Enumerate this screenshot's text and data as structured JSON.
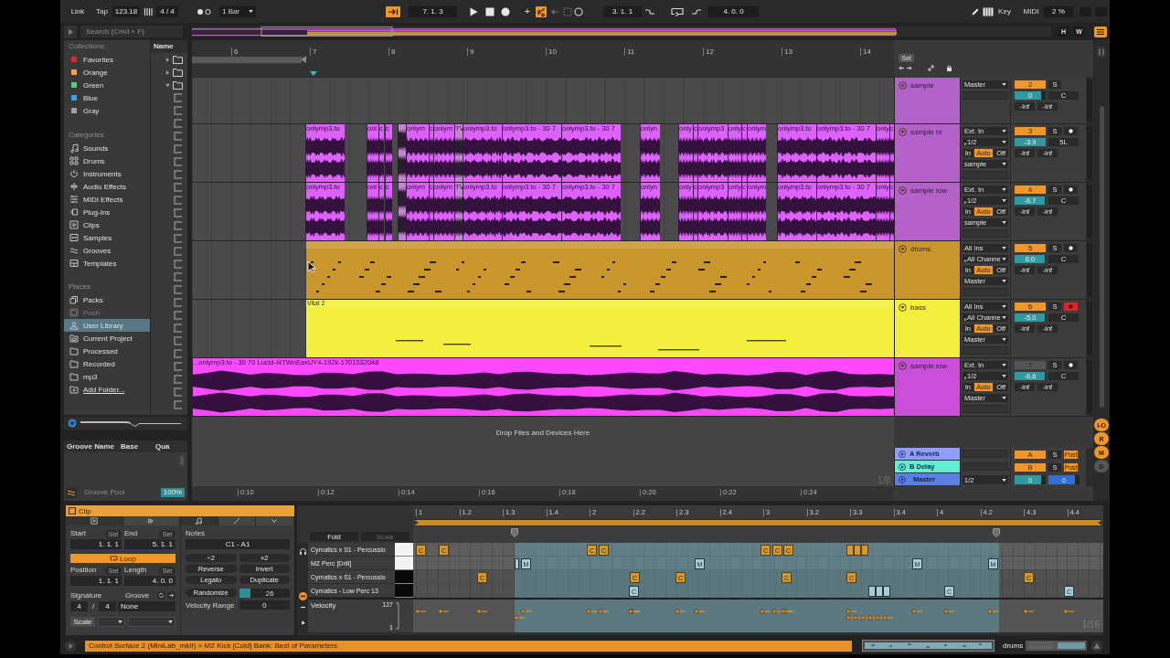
{
  "control_bar": {
    "link": "Link",
    "tap": "Tap",
    "tempo": "123.18",
    "time_signature": "4 / 4",
    "quantization": "1 Bar",
    "follow": true,
    "position": "7. 1. 3",
    "add": "+",
    "automation_arm": true,
    "loop_start": "3. 1. 1",
    "loop_length": "4. 0. 0",
    "key": "Key",
    "midi": "MIDI",
    "cpu": "2 %"
  },
  "search": {
    "placeholder": "Search (Cmd + F)"
  },
  "overview": {
    "buttons": [
      "H",
      "W"
    ]
  },
  "browser": {
    "collections_title": "Collections",
    "collections": [
      {
        "label": "Favorites",
        "color": "#e0282c"
      },
      {
        "label": "Orange",
        "color": "#f0a24c"
      },
      {
        "label": "Green",
        "color": "#4fd47c"
      },
      {
        "label": "Blue",
        "color": "#3ea6e8"
      },
      {
        "label": "Gray",
        "color": "#a2a2a2"
      }
    ],
    "categories_title": "Categories",
    "categories": [
      "Sounds",
      "Drums",
      "Instruments",
      "Audio Effects",
      "MIDI Effects",
      "Plug-Ins",
      "Clips",
      "Samples",
      "Grooves",
      "Templates"
    ],
    "places_title": "Places",
    "places": [
      {
        "label": "Packs",
        "kind": "place",
        "selected": false,
        "disabled": false
      },
      {
        "label": "Push",
        "kind": "place",
        "selected": false,
        "disabled": true
      },
      {
        "label": "User Library",
        "kind": "place",
        "selected": true,
        "disabled": false
      },
      {
        "label": "Current Project",
        "kind": "place",
        "selected": false,
        "disabled": false
      },
      {
        "label": "Processed",
        "kind": "place",
        "selected": false,
        "disabled": false
      },
      {
        "label": "Recorded",
        "kind": "place",
        "selected": false,
        "disabled": false
      },
      {
        "label": "mp3",
        "kind": "place",
        "selected": false,
        "disabled": false
      },
      {
        "label": "Add Folder...",
        "kind": "link",
        "selected": false,
        "disabled": false
      }
    ],
    "name_column": "Name",
    "folders": [
      {
        "expanded": false
      },
      {
        "expanded": false
      },
      {
        "expanded": true
      }
    ]
  },
  "groove_pool": {
    "columns": [
      "Groove Name",
      "Base",
      "Qua"
    ],
    "title": "Groove Pool",
    "amount": "100%"
  },
  "arrangement": {
    "bars": [
      "6",
      "7",
      "8",
      "9",
      "10",
      "11",
      "12",
      "13",
      "14"
    ],
    "set": "Set",
    "tracks": [
      {
        "name": "sample",
        "kind": "group",
        "color": "#b163c9",
        "output": "Master",
        "number": "2",
        "active": true,
        "solo": "S",
        "volume": {
          "value": "0",
          "level": 0.84
        },
        "pan": "C",
        "peaks": [
          "-inf",
          "-inf"
        ]
      },
      {
        "name": "sample hi",
        "kind": "audio",
        "color": "#b461ca",
        "input": "Ext. In",
        "channel": "1/2",
        "monitor": [
          {
            "label": "In",
            "selected": false
          },
          {
            "label": "Auto",
            "selected": true
          },
          {
            "label": "Off",
            "selected": false
          }
        ],
        "output": "sample",
        "number": "3",
        "active": true,
        "solo": "S",
        "armed": false,
        "volume": {
          "value": "-3.9",
          "level": 1
        },
        "pan": "5L",
        "peaks": [
          "-inf",
          "-inf"
        ],
        "clips": [
          {
            "label": "onlymp3.to",
            "selected": false
          },
          {
            "label": "onl",
            "selected": false
          },
          {
            "label": "c",
            "selected": false
          },
          {
            "label": "c",
            "selected": false
          },
          {
            "selected": true
          },
          {
            "label": "onlym",
            "selected": false
          },
          {
            "label": "c",
            "selected": false
          },
          {
            "label": "onlym",
            "selected": false
          },
          {
            "label": "TV",
            "selected": true
          },
          {
            "label": "onlymp3.to",
            "selected": false
          },
          {
            "label": "onlymp3.to - 30 7",
            "selected": false
          },
          {
            "label": "onlymp3.to - 30 7",
            "selected": false
          },
          {
            "label": "onlyn",
            "selected": false
          },
          {
            "label": "only",
            "selected": false
          },
          {
            "label": "c",
            "selected": false
          },
          {
            "label": "onlymp3",
            "selected": false
          },
          {
            "label": "only",
            "selected": false
          },
          {
            "label": "c",
            "selected": false
          },
          {
            "label": "onlym",
            "selected": false
          },
          {
            "label": "onlymp3.to",
            "selected": false
          },
          {
            "label": "onlymp3.to - 30 7",
            "selected": false
          },
          {
            "label": "only",
            "selected": false
          },
          {
            "label": "c",
            "selected": false
          }
        ]
      },
      {
        "name": "sample low",
        "kind": "audio",
        "color": "#b461ca",
        "input": "Ext. In",
        "channel": "1/2",
        "monitor": [
          {
            "label": "In",
            "selected": false
          },
          {
            "label": "Auto",
            "selected": true
          },
          {
            "label": "Off",
            "selected": false
          }
        ],
        "output": "sample",
        "number": "4",
        "active": true,
        "solo": "S",
        "armed": false,
        "volume": {
          "value": "-6.7",
          "level": 0.97
        },
        "pan": "C",
        "peaks": [
          "-inf",
          "-inf"
        ],
        "clips": [
          {
            "label": "onlymp3.to",
            "selected": false
          },
          {
            "label": "onl",
            "selected": false
          },
          {
            "label": "c",
            "selected": false
          },
          {
            "label": "c",
            "selected": false
          },
          {
            "selected": true
          },
          {
            "label": "onlym",
            "selected": false
          },
          {
            "label": "c",
            "selected": false
          },
          {
            "label": "onlym",
            "selected": false
          },
          {
            "label": "TV",
            "selected": true
          },
          {
            "label": "onlymp3.to",
            "selected": false
          },
          {
            "label": "onlymp3.to - 30 7",
            "selected": false
          },
          {
            "label": "onlymp3.to - 30 7",
            "selected": false
          },
          {
            "label": "onlyn",
            "selected": false
          },
          {
            "label": "only",
            "selected": false
          },
          {
            "label": "c",
            "selected": false
          },
          {
            "label": "onlymp3",
            "selected": false
          },
          {
            "label": "only",
            "selected": false
          },
          {
            "label": "c",
            "selected": false
          },
          {
            "label": "onlym",
            "selected": false
          },
          {
            "label": "onlymp3.to",
            "selected": false
          },
          {
            "label": "onlymp3.to - 30 7",
            "selected": false
          },
          {
            "label": "only",
            "selected": false
          },
          {
            "label": "c",
            "selected": false
          }
        ]
      },
      {
        "name": "drums",
        "kind": "midi",
        "color": "#c8962c",
        "input": "All Ins",
        "channel": "All Channe",
        "monitor": [
          {
            "label": "In",
            "selected": false
          },
          {
            "label": "Auto",
            "selected": true
          },
          {
            "label": "Off",
            "selected": false
          }
        ],
        "output": "Master",
        "number": "5",
        "active": true,
        "solo": "S",
        "armed": false,
        "volume": {
          "value": "6.0",
          "level": 0.97
        },
        "pan": "C",
        "peaks": [
          "-inf",
          "-inf"
        ],
        "clips": [
          {
            "selected": false
          }
        ]
      },
      {
        "name": "bass",
        "kind": "midi",
        "color": "#f4ef3c",
        "input": "All Ins",
        "channel": "All Channe",
        "monitor": [
          {
            "label": "In",
            "selected": false
          },
          {
            "label": "Auto",
            "selected": true
          },
          {
            "label": "Off",
            "selected": false
          }
        ],
        "output": "Master",
        "number": "6",
        "active": true,
        "solo": "S",
        "armed": true,
        "volume": {
          "value": "-5.0",
          "level": 0.97
        },
        "pan": "C",
        "peaks": [
          "-inf",
          "-inf"
        ],
        "clips": [
          {
            "label": "Vital 2",
            "selected": false
          }
        ]
      },
      {
        "name": "sample low",
        "kind": "audio",
        "color": "#c94fd9",
        "input": "Ext. In",
        "channel": "1/2",
        "monitor": [
          {
            "label": "In",
            "selected": false
          },
          {
            "label": "Auto",
            "selected": true
          },
          {
            "label": "Off",
            "selected": false
          }
        ],
        "output": "Master",
        "number": "7",
        "active": false,
        "solo": "S",
        "armed": false,
        "volume": {
          "value": "-6.6",
          "level": 0.97
        },
        "pan": "C",
        "peaks": [
          "-inf",
          "-inf"
        ],
        "clips": [
          {
            "label": "...onlymp3.to - 30 70 Lucid-I4TWnEaxUY4-192k-1701032048",
            "selected": false
          }
        ]
      }
    ],
    "drop_hint": "Drop Files and Devices Here",
    "grid": "1/8",
    "returns": [
      {
        "name": "A Reverb",
        "color": "#8f9dfc",
        "number": "A",
        "solo": "S",
        "post": "Post"
      },
      {
        "name": "B Delay",
        "color": "#5ff0d2",
        "number": "B",
        "solo": "S",
        "post": "Post"
      }
    ],
    "master": {
      "name": "Master",
      "color": "#5b7fe2",
      "channel": "1/2",
      "volume": {
        "value": "0",
        "level": 0.84
      },
      "cue": {
        "value": "0",
        "level": 0.84
      }
    },
    "times": [
      "0:10",
      "0:12",
      "0:14",
      "0:16",
      "0:18",
      "0:20",
      "0:22",
      "0:24"
    ]
  },
  "sections": [
    {
      "label": "I-O",
      "on": true
    },
    {
      "label": "R",
      "on": true
    },
    {
      "label": "M",
      "on": true
    },
    {
      "label": "D",
      "on": false
    }
  ],
  "clip_panel": {
    "title": "Clip",
    "sample_tabs": [
      {
        "selected": true
      },
      {
        "selected": false
      }
    ],
    "note_tabs": [
      {
        "selected": true
      },
      {
        "selected": false
      },
      {
        "selected": false
      }
    ],
    "start_label": "Start",
    "start_set": "Set",
    "end_label": "End",
    "end_set": "Set",
    "start": "1. 1. 1",
    "end": "5. 1. 1",
    "loop": {
      "label": "Loop",
      "on": true
    },
    "position_label": "Position",
    "position_set": "Set",
    "length_label": "Length",
    "length_set": "Set",
    "position": "1. 1. 1",
    "length": "4. 0. 0",
    "signature_label": "Signature",
    "groove_label": "Groove",
    "signature_numerator": "4",
    "signature_slash": "/",
    "signature_denominator": "4",
    "groove": "None",
    "scale": "Scale",
    "notes_label": "Notes",
    "note_range": "C1 - A1",
    "note_buttons": [
      "÷2",
      "×2",
      "Reverse",
      "Invert",
      "Legato",
      "Duplicate"
    ],
    "randomize": "Randomize",
    "randomize_amount": {
      "value": "26",
      "level": 0.22
    },
    "velocity_range_label": "Velocity Range",
    "velocity_range": "0"
  },
  "piano_roll": {
    "fold": "Fold",
    "scale": {
      "label": "Scale",
      "disabled": true
    },
    "beats": [
      "1",
      "1.2",
      "1.3",
      "1.4",
      "2",
      "2.2",
      "2.3",
      "2.4",
      "3",
      "3.2",
      "3.3",
      "3.4",
      "4",
      "4.2",
      "4.3",
      "4.4"
    ],
    "rows": [
      {
        "name": "Cymatics x S1 - Percussio",
        "kind": "white",
        "notes": [
          {
            "label": "C",
            "selected": false
          },
          {
            "label": "C",
            "selected": false
          },
          {
            "label": "C",
            "selected": false
          },
          {
            "label": "C",
            "selected": false
          },
          {
            "label": "C",
            "selected": false
          },
          {
            "label": "C",
            "selected": false
          },
          {
            "label": "C",
            "selected": false
          },
          {
            "selected": false
          },
          {
            "selected": false
          },
          {
            "selected": false
          }
        ]
      },
      {
        "name": "MZ Perc [Drill]",
        "kind": "white",
        "notes": [
          {
            "selected": true
          },
          {
            "label": "M",
            "selected": true
          },
          {
            "label": "M",
            "selected": true
          },
          {
            "label": "M",
            "selected": true
          },
          {
            "label": "M",
            "selected": true
          }
        ]
      },
      {
        "name": "Cymatics x S1 - Percussio",
        "kind": "black",
        "notes": [
          {
            "label": "C",
            "selected": false
          },
          {
            "label": "C",
            "selected": false
          },
          {
            "label": "C",
            "selected": false
          },
          {
            "label": "C",
            "selected": false
          },
          {
            "label": "C",
            "selected": false
          },
          {
            "label": "C",
            "selected": false
          }
        ]
      },
      {
        "name": "Cymatics - Low Perc 13",
        "kind": "black",
        "notes": [
          {
            "label": "C",
            "selected": true
          },
          {
            "selected": true
          },
          {
            "selected": true
          },
          {
            "selected": true
          },
          {
            "label": "C",
            "selected": true
          },
          {
            "label": "C",
            "selected": true
          }
        ]
      }
    ],
    "velocity": {
      "label": "Velocity",
      "max": "127",
      "min": "1"
    },
    "grid": "1/16"
  },
  "status_bar": {
    "message": "Control Surface 2 (MiniLab_mkII) > MZ Kick [Cold] Bank: Best of Parameters",
    "track": "drums"
  }
}
